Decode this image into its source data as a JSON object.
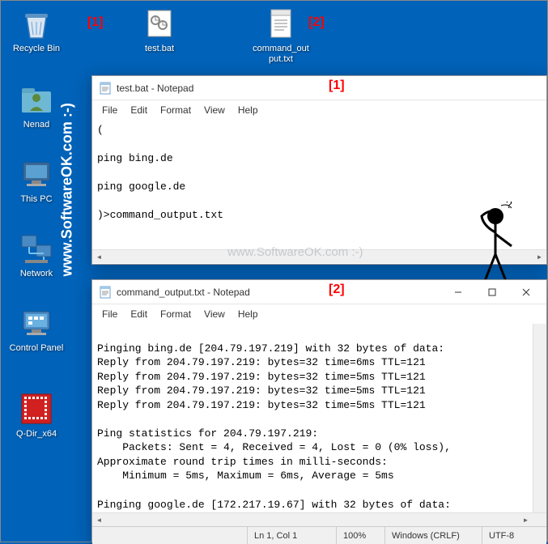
{
  "desktop": {
    "icons": [
      {
        "label": "Recycle Bin",
        "type": "recycle"
      },
      {
        "label": "test.bat",
        "type": "bat"
      },
      {
        "label": "command_output.txt",
        "type": "txt"
      },
      {
        "label": "Nenad",
        "type": "user"
      },
      {
        "label": "This PC",
        "type": "pc"
      },
      {
        "label": "Network",
        "type": "network"
      },
      {
        "label": "Control Panel",
        "type": "cpanel"
      },
      {
        "label": "Q-Dir_x64",
        "type": "qdir"
      }
    ]
  },
  "annotations": {
    "a1": "[1]",
    "a2": "[2]",
    "w1": "[1]",
    "w2": "[2]"
  },
  "watermark": {
    "vertical": "www.SoftwareOK.com :-)",
    "content": "www.SoftwareOK.com :-)"
  },
  "notepad1": {
    "title": "test.bat - Notepad",
    "menu": [
      "File",
      "Edit",
      "Format",
      "View",
      "Help"
    ],
    "content": "(\n\nping bing.de\n\nping google.de\n\n)>command_output.txt"
  },
  "notepad2": {
    "title": "command_output.txt - Notepad",
    "menu": [
      "File",
      "Edit",
      "Format",
      "View",
      "Help"
    ],
    "content": "\nPinging bing.de [204.79.197.219] with 32 bytes of data:\nReply from 204.79.197.219: bytes=32 time=6ms TTL=121\nReply from 204.79.197.219: bytes=32 time=5ms TTL=121\nReply from 204.79.197.219: bytes=32 time=5ms TTL=121\nReply from 204.79.197.219: bytes=32 time=5ms TTL=121\n\nPing statistics for 204.79.197.219:\n    Packets: Sent = 4, Received = 4, Lost = 0 (0% loss),\nApproximate round trip times in milli-seconds:\n    Minimum = 5ms, Maximum = 6ms, Average = 5ms\n\nPinging google.de [172.217.19.67] with 32 bytes of data:",
    "status": {
      "pos": "Ln 1, Col 1",
      "zoom": "100%",
      "eol": "Windows (CRLF)",
      "enc": "UTF-8"
    }
  }
}
